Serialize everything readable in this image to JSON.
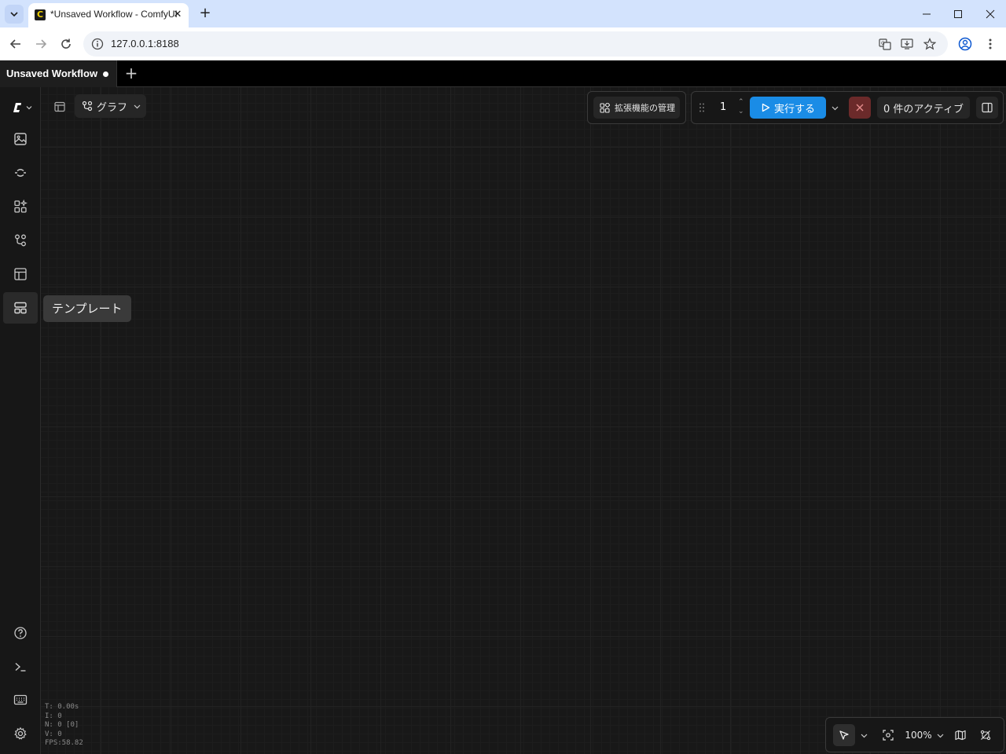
{
  "browser": {
    "tab_title": "*Unsaved Workflow - ComfyUI",
    "url": "127.0.0.1:8188"
  },
  "workflow_tabs": [
    {
      "label": "Unsaved Workflow",
      "unsaved": true
    }
  ],
  "toolbar": {
    "graph_label": "グラフ",
    "extensions_label": "拡張機能の管理",
    "queue_count": "1",
    "run_label": "実行する",
    "active_label": "0 件のアクティブ"
  },
  "sidebar": {
    "tooltip": "テンプレート",
    "items": [
      {
        "name": "images",
        "icon": "image-icon"
      },
      {
        "name": "models",
        "icon": "model-icon"
      },
      {
        "name": "nodes",
        "icon": "node-library-icon"
      },
      {
        "name": "workflows",
        "icon": "workflow-icon"
      },
      {
        "name": "layout",
        "icon": "layout-icon"
      },
      {
        "name": "templates",
        "icon": "template-icon",
        "active": true
      }
    ],
    "bottom_items": [
      {
        "name": "help",
        "icon": "help-icon"
      },
      {
        "name": "terminal",
        "icon": "terminal-icon"
      },
      {
        "name": "shortcuts",
        "icon": "keyboard-icon"
      },
      {
        "name": "settings",
        "icon": "gear-icon"
      }
    ]
  },
  "stats": {
    "t": "T: 0.00s",
    "i": "I: 0",
    "n": "N: 0 [0]",
    "v": "V: 0",
    "fps": "FPS:58.82"
  },
  "canvas_controls": {
    "zoom": "100%"
  },
  "colors": {
    "accent": "#1a8ce6",
    "stop": "#6b2a2a",
    "background": "#161616"
  }
}
